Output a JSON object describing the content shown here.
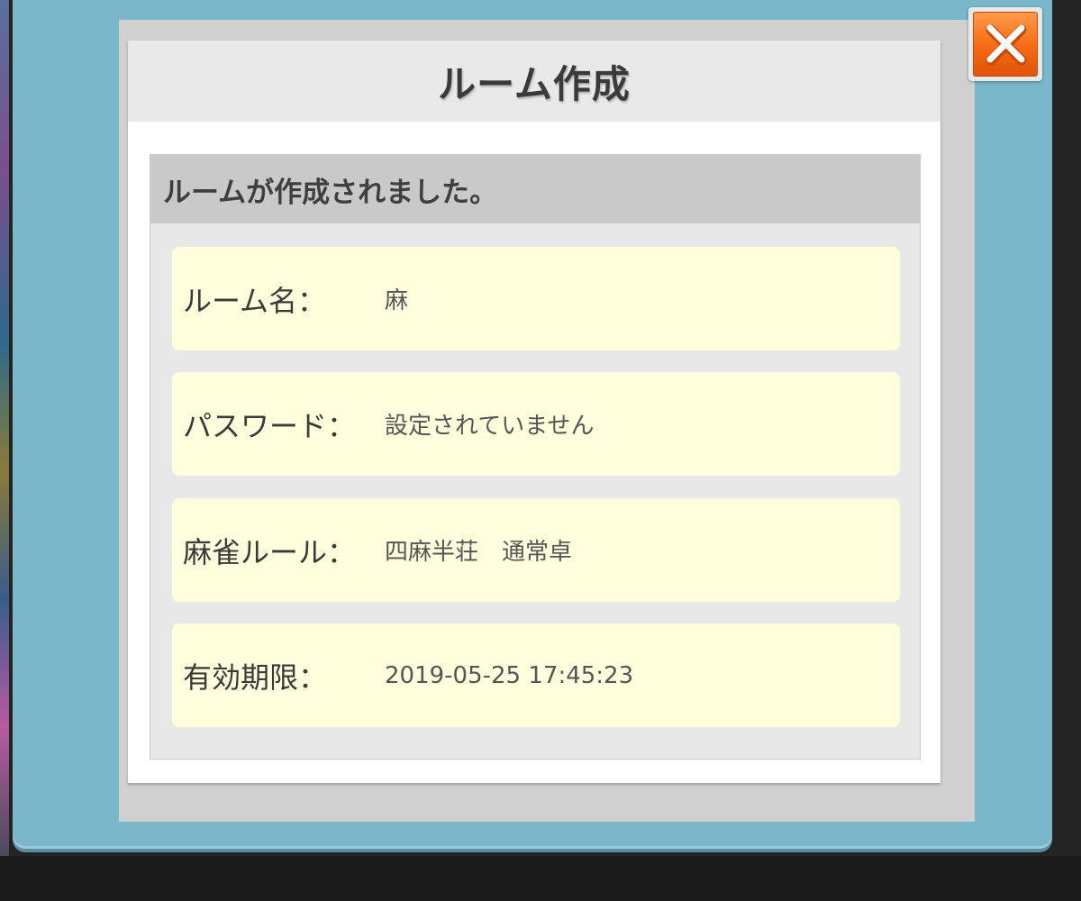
{
  "dialog": {
    "title": "ルーム作成",
    "message": "ルームが作成されました。",
    "close_icon": "close-icon"
  },
  "rows": [
    {
      "label": "ルーム名：",
      "value": "麻"
    },
    {
      "label": "パスワード：",
      "value": "設定されていません"
    },
    {
      "label": "麻雀ルール：",
      "value": "四麻半荘　通常卓"
    },
    {
      "label": "有効期限：",
      "value": "2019-05-25 17:45:23"
    }
  ],
  "colors": {
    "outer_panel": "#79b7cb",
    "row_background": "#ffffde",
    "close_button": "#f56a12"
  }
}
